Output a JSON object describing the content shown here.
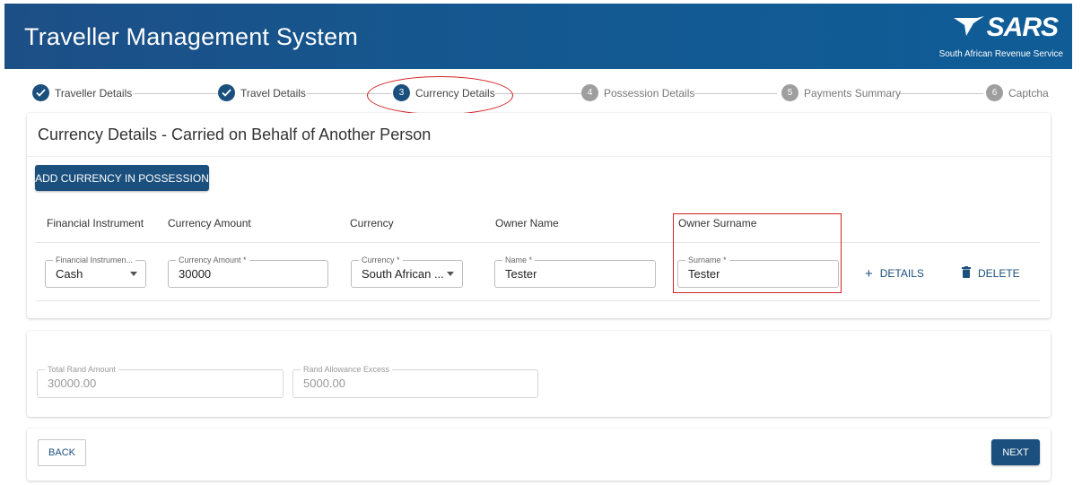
{
  "header": {
    "title": "Traveller Management System",
    "logo_mark": "SARS",
    "logo_subtitle": "South African Revenue Service"
  },
  "stepper": {
    "steps": [
      {
        "number": "1",
        "label": "Traveller Details",
        "state": "done"
      },
      {
        "number": "2",
        "label": "Travel Details",
        "state": "done"
      },
      {
        "number": "3",
        "label": "Currency Details",
        "state": "active"
      },
      {
        "number": "4",
        "label": "Possession Details",
        "state": "pending"
      },
      {
        "number": "5",
        "label": "Payments Summary",
        "state": "pending"
      },
      {
        "number": "6",
        "label": "Captcha",
        "state": "pending"
      }
    ]
  },
  "currency_section": {
    "title": "Currency Details - Carried on Behalf of Another Person",
    "add_button": "ADD CURRENCY IN POSSESSION",
    "columns": [
      "Financial Instrument",
      "Currency Amount",
      "Currency",
      "Owner Name",
      "Owner Surname"
    ],
    "row": {
      "financial_instrument": {
        "label": "Financial Instrumen...",
        "value": "Cash"
      },
      "currency_amount": {
        "label": "Currency Amount *",
        "value": "30000"
      },
      "currency": {
        "label": "Currency *",
        "value": "South African ..."
      },
      "owner_name": {
        "label": "Name *",
        "value": "Tester"
      },
      "owner_surname": {
        "label": "Surname *",
        "value": "Tester"
      },
      "details_label": "DETAILS",
      "delete_label": "DELETE"
    }
  },
  "totals": {
    "total_rand": {
      "label": "Total Rand Amount",
      "value": "30000.00"
    },
    "allowance_excess": {
      "label": "Rand Allowance Excess",
      "value": "5000.00"
    }
  },
  "footer": {
    "back_label": "BACK",
    "next_label": "NEXT"
  },
  "colors": {
    "primary": "#1b4f7d",
    "header": "#135a93",
    "annotation": "#d42121",
    "pending_step": "#9e9e9e"
  },
  "icons": {
    "done_step": "check-icon",
    "details": "plus-icon",
    "delete": "trash-icon",
    "dropdown": "caret-down-icon"
  }
}
